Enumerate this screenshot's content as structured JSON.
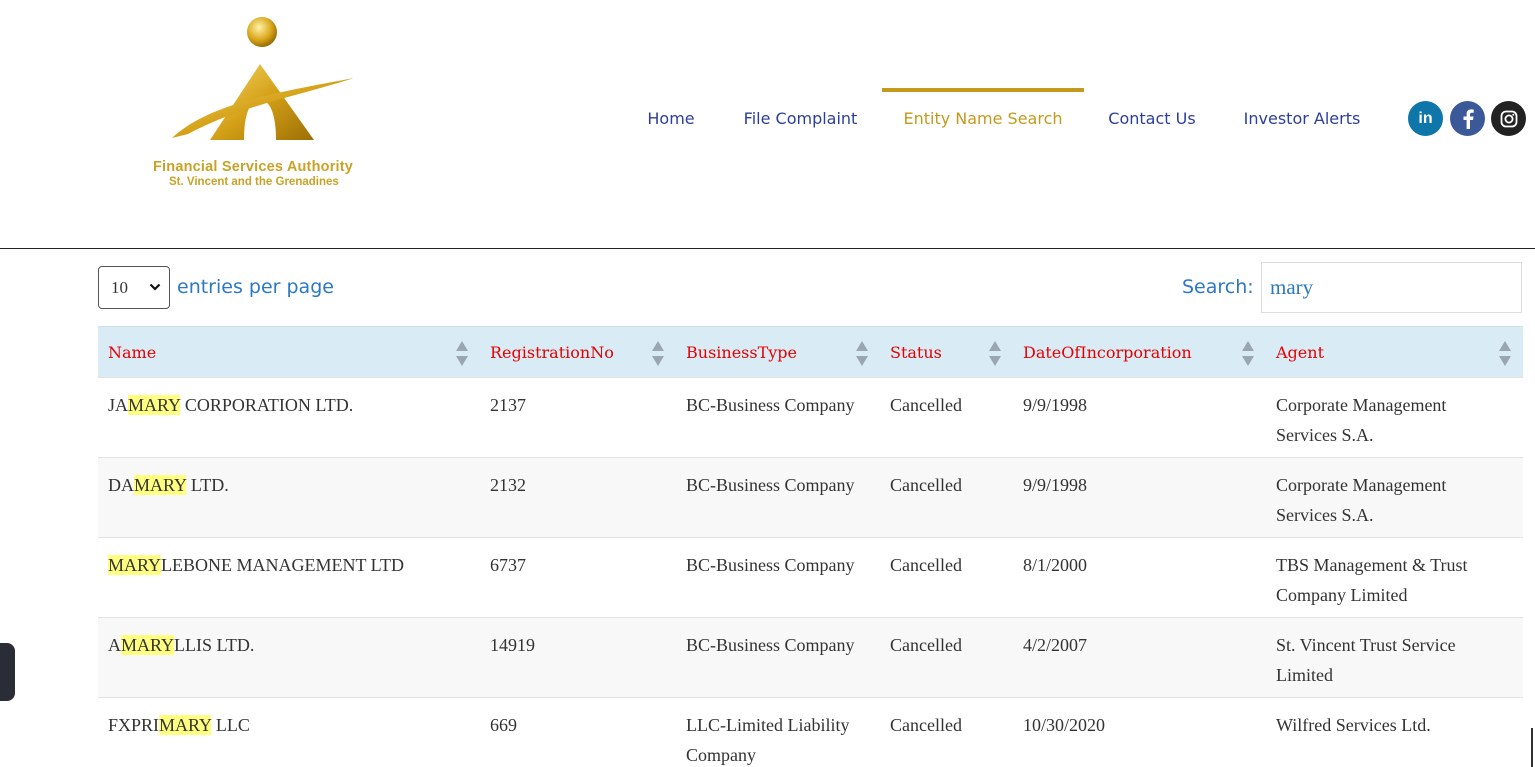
{
  "header": {
    "logo": {
      "org_name": "Financial Services Authority",
      "country": "St. Vincent and the Grenadines"
    },
    "nav": [
      {
        "label": "Home",
        "active": false
      },
      {
        "label": "File Complaint",
        "active": false
      },
      {
        "label": "Entity Name Search",
        "active": true
      },
      {
        "label": "Contact Us",
        "active": false
      },
      {
        "label": "Investor Alerts",
        "active": false
      }
    ],
    "social": [
      {
        "name": "linkedin",
        "glyph": "in",
        "color": "#0e76a8"
      },
      {
        "name": "facebook",
        "glyph": "f",
        "color": "#3b5998"
      },
      {
        "name": "instagram",
        "glyph": "ig",
        "color": "#222222"
      }
    ]
  },
  "controls": {
    "entries_value": "10",
    "entries_label": "entries per page",
    "search_label": "Search:",
    "search_value": "mary"
  },
  "table": {
    "columns": [
      "Name",
      "RegistrationNo",
      "BusinessType",
      "Status",
      "DateOfIncorporation",
      "Agent"
    ],
    "rows": [
      {
        "name_pre": "JA",
        "name_hl": "MARY",
        "name_post": " CORPORATION LTD.",
        "reg": "2137",
        "type": "BC-Business Company",
        "status": "Cancelled",
        "date": "9/9/1998",
        "agent": "Corporate Management Services S.A."
      },
      {
        "name_pre": "DA",
        "name_hl": "MARY",
        "name_post": " LTD.",
        "reg": "2132",
        "type": "BC-Business Company",
        "status": "Cancelled",
        "date": "9/9/1998",
        "agent": "Corporate Management Services S.A."
      },
      {
        "name_pre": "",
        "name_hl": "MARY",
        "name_post": "LEBONE MANAGEMENT LTD",
        "reg": "6737",
        "type": "BC-Business Company",
        "status": "Cancelled",
        "date": "8/1/2000",
        "agent": "TBS Management & Trust Company Limited"
      },
      {
        "name_pre": "A",
        "name_hl": "MARY",
        "name_post": "LLIS LTD.",
        "reg": "14919",
        "type": "BC-Business Company",
        "status": "Cancelled",
        "date": "4/2/2007",
        "agent": "St. Vincent Trust Service Limited"
      },
      {
        "name_pre": "FXPRI",
        "name_hl": "MARY",
        "name_post": " LLC",
        "reg": "669",
        "type": "LLC-Limited Liability Company",
        "status": "Cancelled",
        "date": "10/30/2020",
        "agent": "Wilfred Services Ltd."
      }
    ]
  },
  "colors": {
    "nav_text": "#2c3e9e",
    "nav_active": "#c49a1c",
    "header_text": "#e60000",
    "header_bg": "#d9ecf6",
    "highlight": "#ffff80",
    "control_text": "#2b78c5"
  }
}
